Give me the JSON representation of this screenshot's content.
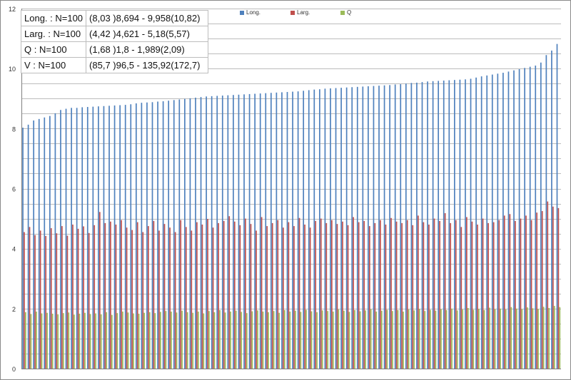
{
  "chart_data": {
    "type": "bar",
    "ylim": [
      0,
      12
    ],
    "yticks": [
      "0",
      "2",
      "4",
      "6",
      "8",
      "10",
      "12"
    ],
    "grid": true,
    "legend_position": "top",
    "series": [
      {
        "name": "Long.",
        "color": "#4f81bd",
        "values": [
          8.03,
          8.13,
          8.27,
          8.32,
          8.37,
          8.42,
          8.51,
          8.62,
          8.66,
          8.69,
          8.69,
          8.71,
          8.72,
          8.73,
          8.74,
          8.75,
          8.76,
          8.77,
          8.78,
          8.79,
          8.81,
          8.84,
          8.86,
          8.87,
          8.88,
          8.9,
          8.91,
          8.93,
          8.95,
          8.97,
          8.99,
          9.01,
          9.03,
          9.05,
          9.07,
          9.08,
          9.09,
          9.1,
          9.11,
          9.12,
          9.13,
          9.14,
          9.15,
          9.16,
          9.17,
          9.18,
          9.19,
          9.2,
          9.21,
          9.22,
          9.23,
          9.24,
          9.26,
          9.28,
          9.3,
          9.31,
          9.33,
          9.34,
          9.35,
          9.36,
          9.37,
          9.38,
          9.39,
          9.4,
          9.41,
          9.42,
          9.43,
          9.44,
          9.45,
          9.47,
          9.48,
          9.5,
          9.52,
          9.53,
          9.55,
          9.57,
          9.58,
          9.59,
          9.6,
          9.61,
          9.62,
          9.63,
          9.64,
          9.66,
          9.7,
          9.74,
          9.77,
          9.8,
          9.83,
          9.86,
          9.9,
          9.94,
          9.98,
          10.02,
          10.06,
          10.1,
          10.2,
          10.45,
          10.6,
          10.82
        ]
      },
      {
        "name": "Larg.",
        "color": "#c0504d",
        "values": [
          4.55,
          4.72,
          4.45,
          4.6,
          4.42,
          4.68,
          4.51,
          4.75,
          4.43,
          4.8,
          4.66,
          4.74,
          4.52,
          4.78,
          5.22,
          4.85,
          4.9,
          4.8,
          4.95,
          4.7,
          4.62,
          4.88,
          4.55,
          4.75,
          4.92,
          4.6,
          4.82,
          4.7,
          4.55,
          4.95,
          4.72,
          4.6,
          4.88,
          4.8,
          4.99,
          4.7,
          4.85,
          4.92,
          5.08,
          4.9,
          4.78,
          5.0,
          4.82,
          4.6,
          5.05,
          4.75,
          4.85,
          4.95,
          4.7,
          4.88,
          4.75,
          5.02,
          4.8,
          4.7,
          4.92,
          5.0,
          4.85,
          4.95,
          4.82,
          4.9,
          4.78,
          5.05,
          4.88,
          4.92,
          4.75,
          4.85,
          4.95,
          4.8,
          5.02,
          4.9,
          4.85,
          4.95,
          4.78,
          5.1,
          4.88,
          4.8,
          5.0,
          4.92,
          5.18,
          4.85,
          4.95,
          4.72,
          5.05,
          4.9,
          4.8,
          5.0,
          4.85,
          4.88,
          4.95,
          5.1,
          5.15,
          4.92,
          5.0,
          5.1,
          4.95,
          5.2,
          5.25,
          5.57,
          5.4,
          5.35
        ]
      },
      {
        "name": "Q",
        "color": "#9bbb59",
        "values": [
          1.88,
          1.82,
          1.9,
          1.84,
          1.86,
          1.83,
          1.81,
          1.85,
          1.87,
          1.8,
          1.83,
          1.86,
          1.82,
          1.84,
          1.81,
          1.88,
          1.79,
          1.85,
          1.9,
          1.87,
          1.84,
          1.83,
          1.86,
          1.88,
          1.85,
          1.89,
          1.92,
          1.9,
          1.87,
          1.93,
          1.88,
          1.86,
          1.9,
          1.84,
          1.92,
          1.88,
          1.95,
          1.87,
          1.9,
          1.93,
          1.89,
          1.85,
          1.91,
          1.94,
          1.9,
          1.88,
          1.92,
          1.86,
          1.95,
          1.9,
          1.93,
          1.89,
          1.96,
          1.91,
          1.88,
          1.94,
          1.92,
          1.9,
          1.97,
          1.93,
          1.89,
          1.95,
          1.91,
          1.94,
          1.98,
          1.9,
          1.93,
          1.96,
          1.92,
          1.95,
          1.9,
          1.97,
          1.94,
          1.99,
          1.92,
          1.96,
          1.93,
          1.98,
          1.95,
          2.0,
          1.94,
          1.97,
          2.02,
          1.96,
          1.99,
          1.95,
          2.03,
          1.98,
          2.0,
          1.97,
          2.05,
          2.0,
          1.98,
          2.04,
          2.01,
          1.99,
          2.06,
          2.02,
          2.09,
          2.05
        ]
      }
    ],
    "stats_table": [
      {
        "label": "Long. : N=100",
        "value": "(8,03 )8,694 - 9,958(10,82)"
      },
      {
        "label": "Larg. : N=100",
        "value": "(4,42 )4,621 - 5,18(5,57)"
      },
      {
        "label": "Q : N=100",
        "value": "(1,68 )1,8 - 1,989(2,09)"
      },
      {
        "label": "V : N=100",
        "value": "(85,7 )96,5 - 135,92(172,7)"
      }
    ]
  }
}
